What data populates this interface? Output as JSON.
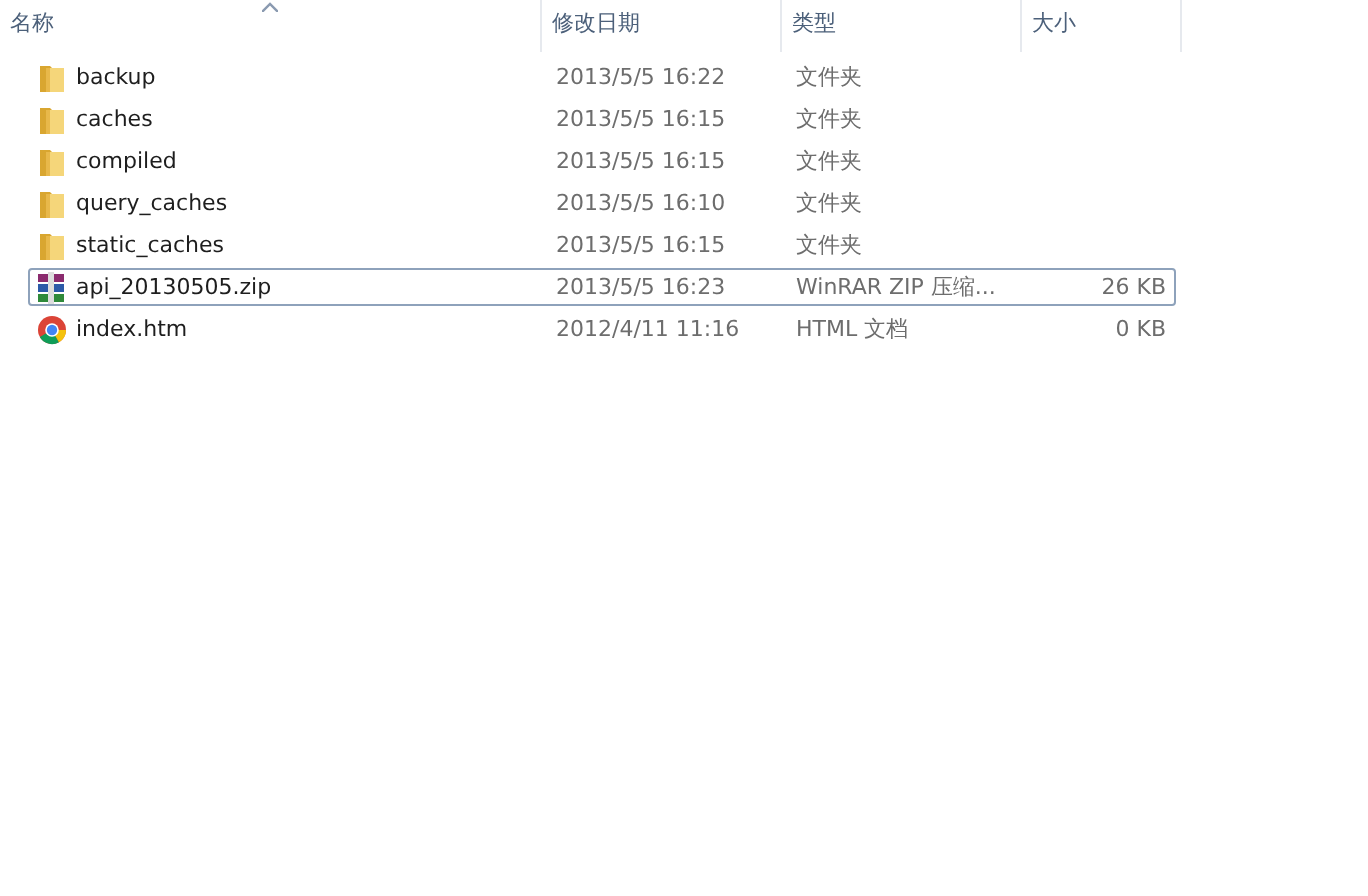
{
  "columns": [
    {
      "label": "名称",
      "sorted": true
    },
    {
      "label": "修改日期",
      "sorted": false
    },
    {
      "label": "类型",
      "sorted": false
    },
    {
      "label": "大小",
      "sorted": false
    }
  ],
  "rows": [
    {
      "kind": "folder",
      "name": "backup",
      "date": "2013/5/5 16:22",
      "type": "文件夹",
      "focused": false
    },
    {
      "kind": "folder",
      "name": "caches",
      "date": "2013/5/5 16:15",
      "type": "文件夹",
      "focused": false
    },
    {
      "kind": "folder",
      "name": "compiled",
      "date": "2013/5/5 16:15",
      "type": "文件夹",
      "focused": false
    },
    {
      "kind": "folder",
      "name": "query_caches",
      "date": "2013/5/5 16:10",
      "type": "文件夹",
      "focused": false
    },
    {
      "kind": "folder",
      "name": "static_caches",
      "date": "2013/5/5 16:15",
      "type": "文件夹",
      "focused": false
    },
    {
      "kind": "archive",
      "name": "api_20130505.zip",
      "date": "2013/5/5 16:23",
      "type": "WinRAR ZIP 压缩...",
      "size": "26 KB",
      "focused": true
    },
    {
      "kind": "web",
      "name": "index.htm",
      "date": "2012/4/11 11:16",
      "type": "HTML 文档",
      "size": "0 KB",
      "focused": false
    }
  ]
}
